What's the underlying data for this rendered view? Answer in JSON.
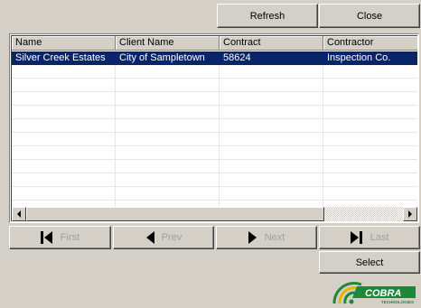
{
  "toolbar": {
    "refresh_label": "Refresh",
    "close_label": "Close"
  },
  "grid": {
    "columns": [
      "Name",
      "Client Name",
      "Contract",
      "Contractor"
    ],
    "rows": [
      [
        "Silver Creek Estates",
        "City of Sampletown",
        "58624",
        "Inspection Co."
      ]
    ],
    "selected_row": 0
  },
  "nav": {
    "first_label": "First",
    "prev_label": "Prev",
    "next_label": "Next",
    "last_label": "Last"
  },
  "actions": {
    "select_label": "Select"
  },
  "logo": {
    "text": "COBRA",
    "subtext": "TECHNOLOGIES",
    "green": "#1a8a3a",
    "yellow": "#e8b400"
  },
  "colors": {
    "selection": "#0a246a",
    "face": "#d4d0c8"
  }
}
